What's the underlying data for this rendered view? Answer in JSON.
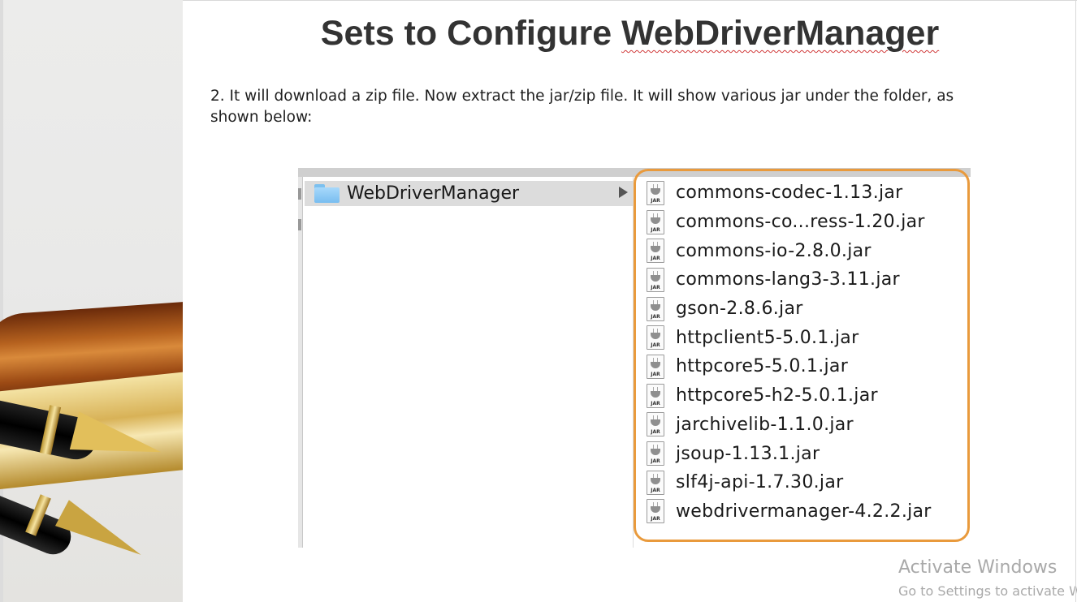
{
  "slide": {
    "title_prefix": "Sets to Configure ",
    "title_highlight": "WebDriverManager",
    "body_text": "2. It will download a zip file. Now extract the jar/zip file. It will show various jar under the folder, as shown below:"
  },
  "finder": {
    "selected_folder": {
      "label": "WebDriverManager",
      "icon": "folder-icon"
    },
    "file_icon": "jar-file-icon",
    "jar_badge": "JAR",
    "files": [
      "commons-codec-1.13.jar",
      "commons-co...ress-1.20.jar",
      "commons-io-2.8.0.jar",
      "commons-lang3-3.11.jar",
      "gson-2.8.6.jar",
      "httpclient5-5.0.1.jar",
      "httpcore5-5.0.1.jar",
      "httpcore5-h2-5.0.1.jar",
      "jarchivelib-1.1.0.jar",
      "jsoup-1.13.1.jar",
      "slf4j-api-1.7.30.jar",
      "webdrivermanager-4.2.2.jar"
    ]
  },
  "watermark": {
    "title": "Activate Windows",
    "subtitle": "Go to Settings to activate W"
  },
  "colors": {
    "highlight": "#e99a3c",
    "title": "#333333",
    "folder": "#78bdf0"
  }
}
